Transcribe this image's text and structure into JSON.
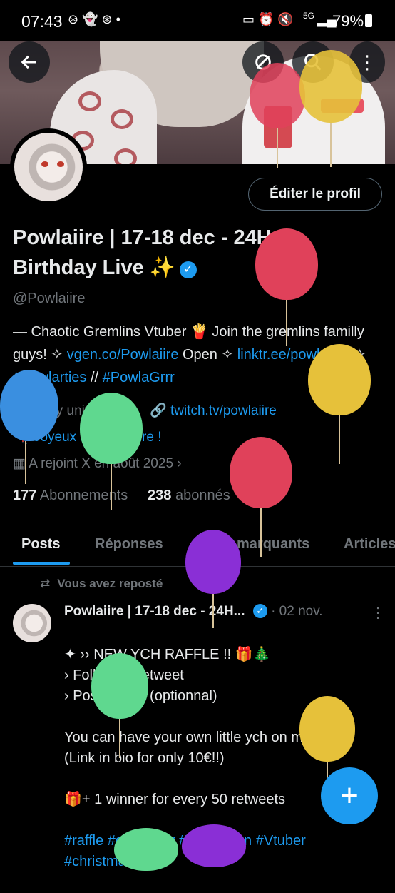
{
  "status_bar": {
    "time": "07:43",
    "battery": "79%",
    "network": "5G"
  },
  "header": {
    "back_icon": "arrow-left-icon",
    "search_icon": "search-icon",
    "more_icon": "more-icon"
  },
  "profile": {
    "edit_label": "Éditer le profil",
    "name": "Powlaiire | 17-18 dec - 24H Birthday Live ✨",
    "handle": "@Powlaiire",
    "bio_text1": "— Chaotic Gremlins Vtuber 🍟  Join the gremlins familly guys!  ✧ ",
    "bio_link1": "vgen.co/Powlaiire",
    "bio_text2": " Open ✧ ",
    "bio_link2": "linktr.ee/powlaiiire",
    "bio_text3": " ✧ ",
    "bio_tag1": "#Powlarties",
    "bio_text4": " // ",
    "bio_tag2": "#PowlaGrrr",
    "location": "🪐 My universe",
    "website": "twitch.tv/powlaiire",
    "birthday": "Joyeux anniversaire !",
    "joined": "A rejoint X en août 2025",
    "following_count": "177",
    "following_label": "Abonnements",
    "followers_count": "238",
    "followers_label": "abonnés"
  },
  "tabs": [
    "Posts",
    "Réponses",
    "Posts marquants",
    "Articles"
  ],
  "post": {
    "repost_label": "Vous avez reposté",
    "author": "Powlaiire | 17-18 dec - 24H...",
    "date": "· 02 nov.",
    "text": "✦ ›› NEW YCH RAFFLE !! 🎁🎄\n› Follow & Retweet\n› Post ur png (optionnal)\n\nYou can have your own little ych on my vgen!!\n(Link in bio for only 10€!!)\n\n🎁+ 1 winner for every 50 retweets",
    "hashtags": "#raffle #giveaway #ych #vgen #Vtuber\n#christmas"
  },
  "fab_label": "+",
  "colors": {
    "accent": "#1d9bf0",
    "balloon_red": "#e0415a",
    "balloon_yellow": "#e6c13a",
    "balloon_green": "#5fd88f",
    "balloon_blue": "#3a8fe0",
    "balloon_purple": "#8a2fd6"
  }
}
